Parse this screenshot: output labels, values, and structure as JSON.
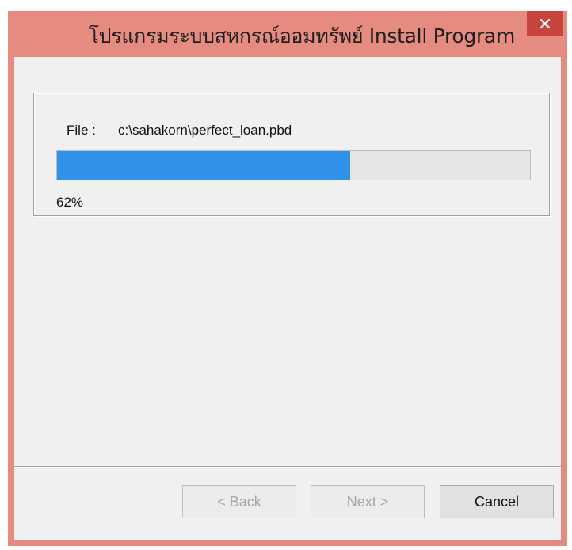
{
  "window": {
    "title": "โปรแกรมระบบสหกรณ์ออมทรัพย์ Install Program",
    "close_icon": "close-icon"
  },
  "progress": {
    "file_label": "File :",
    "file_path": "c:\\sahakorn\\perfect_loan.pbd",
    "percent_value": 62,
    "percent_text": "62%",
    "fill_color": "#3092e8"
  },
  "buttons": {
    "back_label": "< Back",
    "next_label": "Next >",
    "cancel_label": "Cancel"
  },
  "colors": {
    "titlebar": "#e68b80",
    "close_button": "#c7453c",
    "client_bg": "#f0f0f0"
  }
}
